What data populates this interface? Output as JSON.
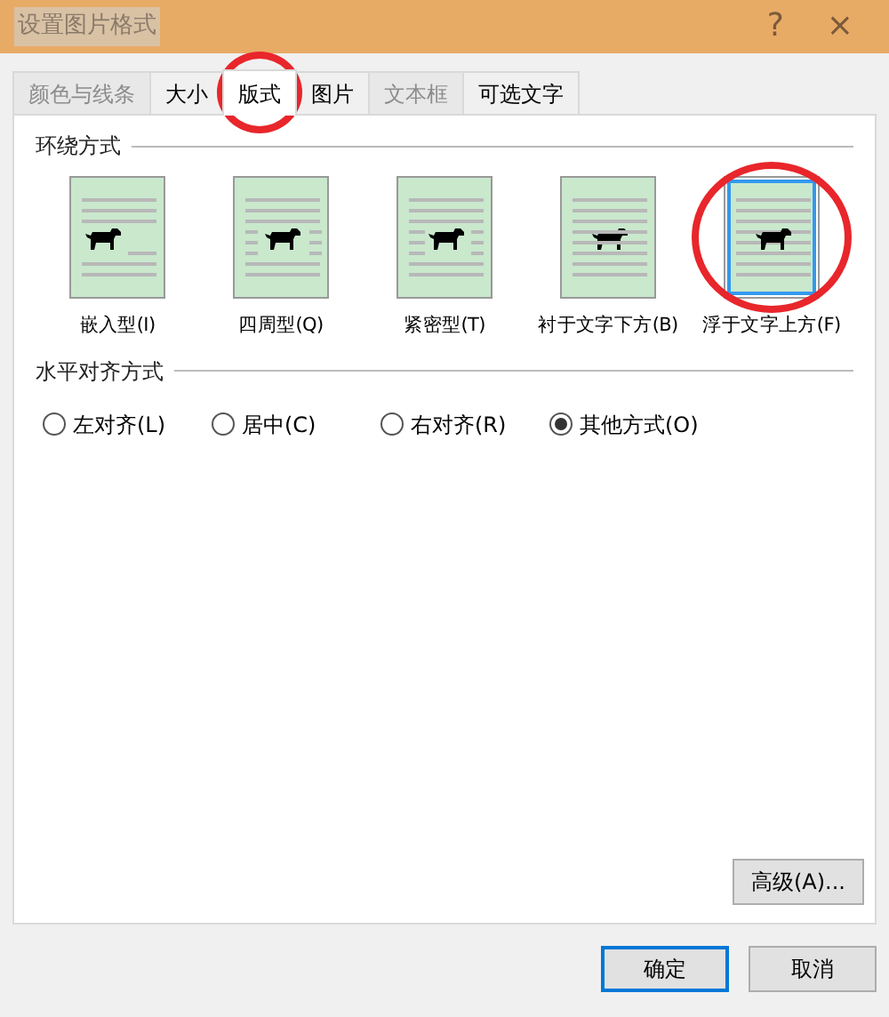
{
  "window": {
    "title": "设置图片格式",
    "help": "?",
    "close": "×"
  },
  "tabs": [
    {
      "label": "颜色与线条",
      "selected": false,
      "disabled": true,
      "circled": false
    },
    {
      "label": "大小",
      "selected": false,
      "disabled": false,
      "circled": false
    },
    {
      "label": "版式",
      "selected": true,
      "disabled": false,
      "circled": true
    },
    {
      "label": "图片",
      "selected": false,
      "disabled": false,
      "circled": false
    },
    {
      "label": "文本框",
      "selected": false,
      "disabled": true,
      "circled": false
    },
    {
      "label": "可选文字",
      "selected": false,
      "disabled": false,
      "circled": false
    }
  ],
  "wrap_section": {
    "title": "环绕方式",
    "options": [
      {
        "label": "嵌入型(I)",
        "kind": "inline",
        "selected": false,
        "circled": false
      },
      {
        "label": "四周型(Q)",
        "kind": "square",
        "selected": false,
        "circled": false
      },
      {
        "label": "紧密型(T)",
        "kind": "tight",
        "selected": false,
        "circled": false
      },
      {
        "label": "衬于文字下方(B)",
        "kind": "behind",
        "selected": false,
        "circled": false
      },
      {
        "label": "浮于文字上方(F)",
        "kind": "front",
        "selected": true,
        "circled": true
      }
    ]
  },
  "align_section": {
    "title": "水平对齐方式",
    "options": [
      {
        "label": "左对齐(L)",
        "selected": false
      },
      {
        "label": "居中(C)",
        "selected": false
      },
      {
        "label": "右对齐(R)",
        "selected": false
      },
      {
        "label": "其他方式(O)",
        "selected": true
      }
    ]
  },
  "advanced_button": "高级(A)...",
  "buttons": [
    {
      "label": "确定",
      "default": true
    },
    {
      "label": "取消",
      "default": false
    }
  ]
}
